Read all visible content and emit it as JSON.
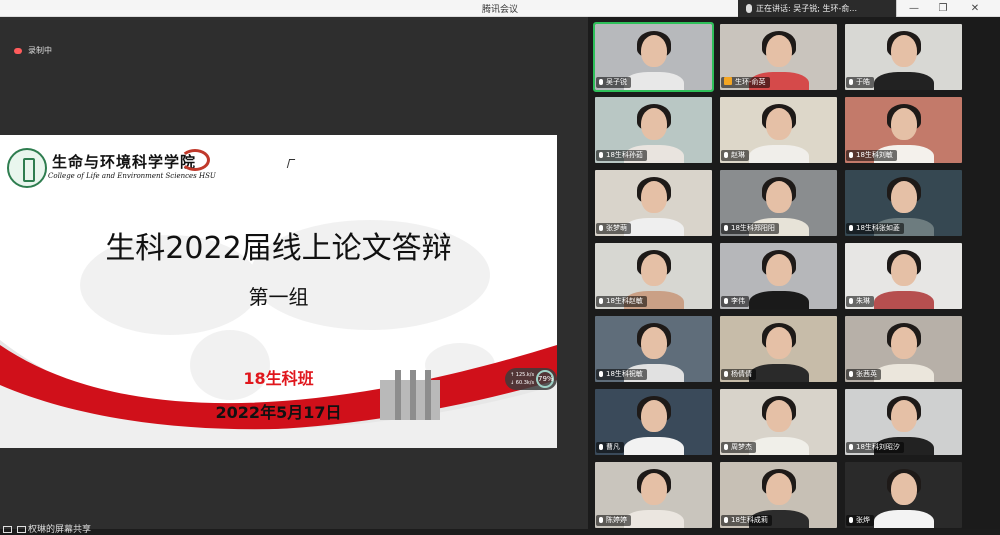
{
  "app": {
    "title": "腾讯会议",
    "speaking_label": "正在讲话: 吴子锐; 生环-俞..."
  },
  "recording": {
    "label": "录制中"
  },
  "slide": {
    "school_cn": "生命与环境科学学院",
    "school_en": "College of Life and Environment Sciences HSU",
    "title": "生科2022届线上论文答辩",
    "group": "第一组",
    "class": "18生科班",
    "date": "2022年5月17日",
    "widget": {
      "up": "↑ 125.k/s",
      "down": "↓ 60.3k/s",
      "value": "79%"
    }
  },
  "share": {
    "label": "权琳的屏幕共享"
  },
  "participants": [
    {
      "name": "吴子锐",
      "active": true,
      "bg": "#b7b9bc",
      "shirt": "#e8e8e8",
      "hair": "#1e1a18",
      "host": false
    },
    {
      "name": "生环-俞英",
      "active": false,
      "bg": "#c9c4bd",
      "shirt": "#d54a4a",
      "hair": "#1e1a18",
      "host": true
    },
    {
      "name": "于皓",
      "active": false,
      "bg": "#d8d8d4",
      "shirt": "#222222",
      "hair": "#1e1a18",
      "host": false
    },
    {
      "name": "18生科孙茹",
      "active": false,
      "bg": "#b9c7c4",
      "shirt": "#e9e4df",
      "hair": "#1e1a18",
      "host": false
    },
    {
      "name": "赵琳",
      "active": false,
      "bg": "#ddd7c9",
      "shirt": "#f0eeea",
      "hair": "#1e1a18",
      "host": false
    },
    {
      "name": "18生科刘敏",
      "active": false,
      "bg": "#c37a6a",
      "shirt": "#f4f1ec",
      "hair": "#1e1a18",
      "host": false
    },
    {
      "name": "张梦萌",
      "active": false,
      "bg": "#d9d4cb",
      "shirt": "#efefef",
      "hair": "#1e1a18",
      "host": false
    },
    {
      "name": "18生科郑阳阳",
      "active": false,
      "bg": "#8a8d8f",
      "shirt": "#e7e3d8",
      "hair": "#1e1a18",
      "host": false
    },
    {
      "name": "18生科张如菱",
      "active": false,
      "bg": "#364852",
      "shirt": "#6d7c7f",
      "hair": "#1e1a18",
      "host": false
    },
    {
      "name": "18生科赵敏",
      "active": false,
      "bg": "#d7d7d2",
      "shirt": "#caa086",
      "hair": "#1e1a18",
      "host": false
    },
    {
      "name": "李伟",
      "active": false,
      "bg": "#b6b7ba",
      "shirt": "#1a1a1a",
      "hair": "#1e1a18",
      "host": false
    },
    {
      "name": "朱琳",
      "active": false,
      "bg": "#e7e6e4",
      "shirt": "#b64f4f",
      "hair": "#1e1a18",
      "host": false
    },
    {
      "name": "18生科祝敏",
      "active": false,
      "bg": "#5f6d7a",
      "shirt": "#e1e1e1",
      "hair": "#1e1a18",
      "host": false
    },
    {
      "name": "杨倩倩",
      "active": false,
      "bg": "#c7bca9",
      "shirt": "#2a2a2a",
      "hair": "#1e1a18",
      "host": false
    },
    {
      "name": "张茜英",
      "active": false,
      "bg": "#b7b0a8",
      "shirt": "#ebe6dc",
      "hair": "#1e1a18",
      "host": false
    },
    {
      "name": "曹凡",
      "active": false,
      "bg": "#3a4a5a",
      "shirt": "#f2f2f2",
      "hair": "#1e1a18",
      "host": false
    },
    {
      "name": "周梦杰",
      "active": false,
      "bg": "#d8d3ca",
      "shirt": "#f0efe9",
      "hair": "#1e1a18",
      "host": false
    },
    {
      "name": "18生科刘昭汐",
      "active": false,
      "bg": "#cfd0d0",
      "shirt": "#222222",
      "hair": "#1e1a18",
      "host": false
    },
    {
      "name": "陈婷婷",
      "active": false,
      "bg": "#c9c5bd",
      "shirt": "#ebe6e0",
      "hair": "#1e1a18",
      "host": false
    },
    {
      "name": "18生科成莉",
      "active": false,
      "bg": "#c7c0b5",
      "shirt": "#2c2c2c",
      "hair": "#1e1a18",
      "host": false
    },
    {
      "name": "张烨",
      "active": false,
      "bg": "#2a2a2a",
      "shirt": "#f3f3f3",
      "hair": "#1e1a18",
      "host": false
    }
  ]
}
